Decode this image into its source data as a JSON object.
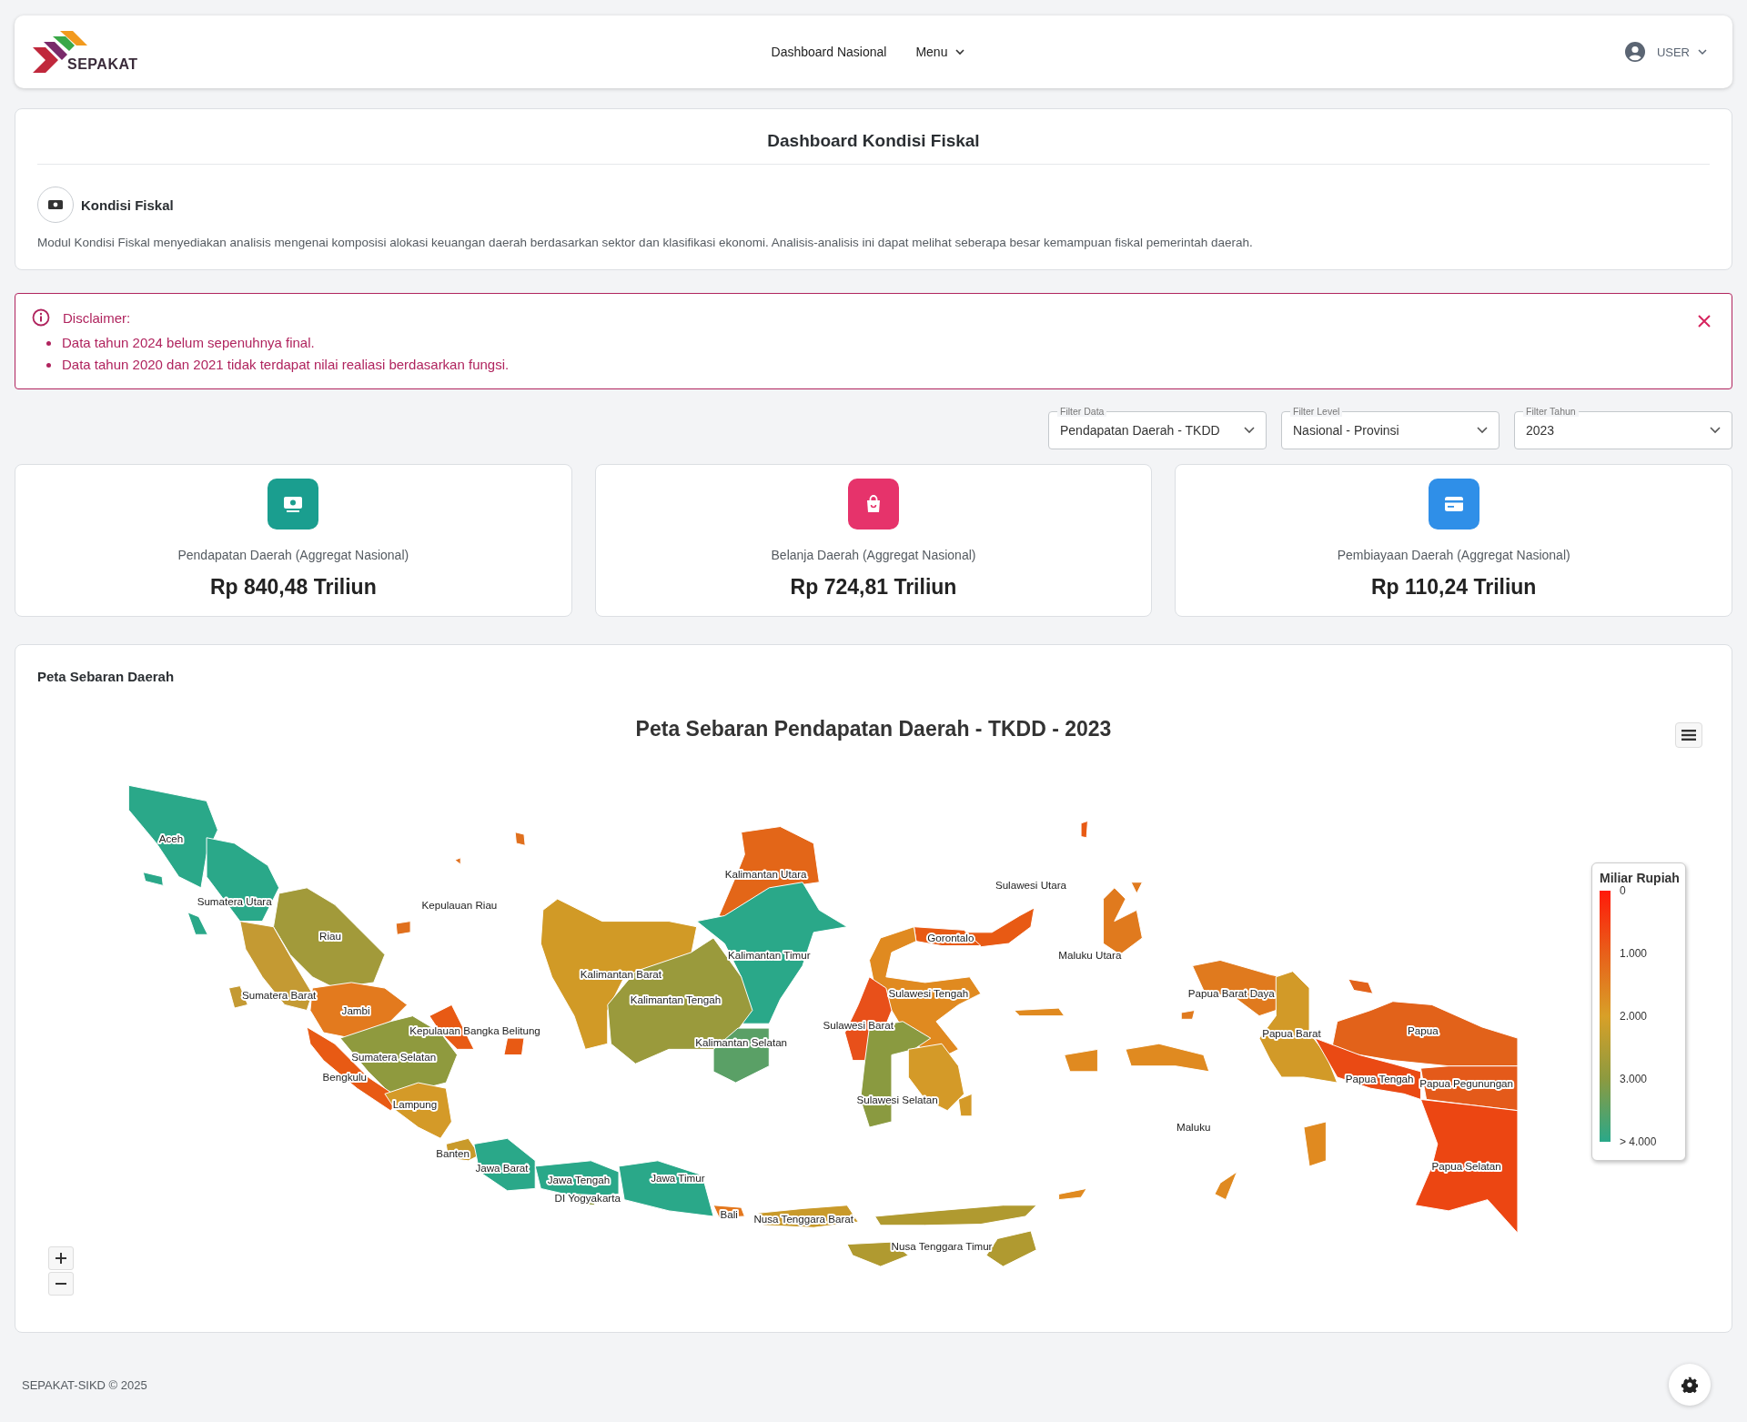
{
  "header": {
    "logo_text": "SEPAKAT",
    "nav": [
      {
        "label": "Dashboard Nasional",
        "kind": "link"
      },
      {
        "label": "Menu",
        "kind": "dropdown"
      }
    ],
    "user": {
      "label": "USER"
    }
  },
  "page": {
    "title": "Dashboard Kondisi Fiskal",
    "section_title": "Kondisi Fiskal",
    "description": "Modul Kondisi Fiskal menyediakan analisis mengenai komposisi alokasi keuangan daerah berdasarkan sektor dan klasifikasi ekonomi. Analisis-analisis ini dapat melihat seberapa besar kemampuan fiskal pemerintah daerah."
  },
  "disclaimer": {
    "title": "Disclaimer:",
    "items": [
      "Data tahun 2024 belum sepenuhnya final.",
      "Data tahun 2020 dan 2021 tidak terdapat nilai realiasi berdasarkan fungsi."
    ]
  },
  "filters": [
    {
      "label": "Filter Data",
      "value": "Pendapatan Daerah - TKDD"
    },
    {
      "label": "Filter Level",
      "value": "Nasional - Provinsi"
    },
    {
      "label": "Filter Tahun",
      "value": "2023"
    }
  ],
  "stats": [
    {
      "kind": "money",
      "color": "#1a9e8f",
      "label": "Pendapatan Daerah (Aggregat Nasional)",
      "value": "Rp 840,48 Triliun"
    },
    {
      "kind": "bag",
      "color": "#e6336b",
      "label": "Belanja Daerah (Aggregat Nasional)",
      "value": "Rp 724,81 Triliun"
    },
    {
      "kind": "card",
      "color": "#2f8fe8",
      "label": "Pembiayaan Daerah (Aggregat Nasional)",
      "value": "Rp 110,24 Triliun"
    }
  ],
  "map": {
    "card_title": "Peta Sebaran Daerah",
    "title": "Peta Sebaran Pendapatan Daerah - TKDD - 2023",
    "legend": {
      "title": "Miliar Rupiah",
      "ticks": [
        "0",
        "1.000",
        "2.000",
        "3.000",
        "> 4.000"
      ]
    },
    "regions": [
      {
        "name": "Aceh",
        "color": "#2aa889"
      },
      {
        "name": "Sumatera Utara",
        "color": "#2aa889"
      },
      {
        "name": "Riau",
        "color": "#a29a3a"
      },
      {
        "name": "Kepulauan Riau",
        "color": "#e0701e"
      },
      {
        "name": "Sumatera Barat",
        "color": "#c49a33"
      },
      {
        "name": "Jambi",
        "color": "#e37a1e"
      },
      {
        "name": "Kepulauan Bangka Belitung",
        "color": "#e85a14"
      },
      {
        "name": "Sumatera Selatan",
        "color": "#8f9a3e"
      },
      {
        "name": "Bengkulu",
        "color": "#e85a14"
      },
      {
        "name": "Lampung",
        "color": "#d49a28"
      },
      {
        "name": "Banten",
        "color": "#c99a2a"
      },
      {
        "name": "Jawa Barat",
        "color": "#2aa889"
      },
      {
        "name": "Jawa Tengah",
        "color": "#2aa889"
      },
      {
        "name": "DI Yogyakarta",
        "color": "#8f9a3e"
      },
      {
        "name": "Jawa Timur",
        "color": "#2aa889"
      },
      {
        "name": "Bali",
        "color": "#e4781e"
      },
      {
        "name": "Nusa Tenggara Barat",
        "color": "#c99a2a"
      },
      {
        "name": "Nusa Tenggara Timur",
        "color": "#b09a30"
      },
      {
        "name": "Kalimantan Utara",
        "color": "#e36618"
      },
      {
        "name": "Kalimantan Timur",
        "color": "#2aa889"
      },
      {
        "name": "Kalimantan Barat",
        "color": "#d19a26"
      },
      {
        "name": "Kalimantan Tengah",
        "color": "#9a9a3c"
      },
      {
        "name": "Kalimantan Selatan",
        "color": "#5aa066"
      },
      {
        "name": "Sulawesi Utara",
        "color": "#e85a14"
      },
      {
        "name": "Gorontalo",
        "color": "#e85a14"
      },
      {
        "name": "Sulawesi Tengah",
        "color": "#e08a20"
      },
      {
        "name": "Sulawesi Barat",
        "color": "#e8501a"
      },
      {
        "name": "Sulawesi Selatan",
        "color": "#8a9a40"
      },
      {
        "color": "#d49a28"
      },
      {
        "name": "Maluku Utara",
        "color": "#e07a1e"
      },
      {
        "name": "Maluku",
        "color": "#e08a20"
      },
      {
        "name": "Papua Barat Daya",
        "color": "#e07a1e"
      },
      {
        "name": "Papua Barat",
        "color": "#d29a28"
      },
      {
        "name": "Papua",
        "color": "#e2621a"
      },
      {
        "name": "Papua Tengah",
        "color": "#ea4a14"
      },
      {
        "name": "Papua Pegunungan",
        "color": "#e45a1a"
      },
      {
        "name": "Papua Selatan",
        "color": "#ec4612"
      }
    ]
  },
  "footer": "SEPAKAT-SIKD © 2025"
}
